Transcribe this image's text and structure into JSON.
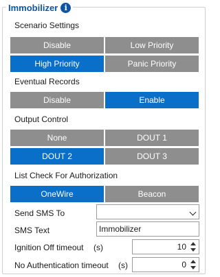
{
  "group": {
    "title": "Immobilizer"
  },
  "scenario": {
    "label": "Scenario Settings",
    "options": [
      "Disable",
      "Low Priority",
      "High Priority",
      "Panic Priority"
    ],
    "selected": "High Priority"
  },
  "eventual": {
    "label": "Eventual Records",
    "options": [
      "Disable",
      "Enable"
    ],
    "selected": "Enable"
  },
  "output": {
    "label": "Output Control",
    "options": [
      "None",
      "DOUT 1",
      "DOUT 2",
      "DOUT 3"
    ],
    "selected": "DOUT 2"
  },
  "list_check": {
    "label": "List Check For Authorization",
    "options": [
      "OneWire",
      "Beacon"
    ],
    "selected": "OneWire"
  },
  "sms_to": {
    "label": "Send SMS To",
    "value": ""
  },
  "sms_text": {
    "label": "SMS Text",
    "value": "Immobilizer"
  },
  "ignition_timeout": {
    "label": "Ignition Off timeout",
    "unit": "(s)",
    "value": "10"
  },
  "no_auth_timeout": {
    "label": "No Authentication timeout",
    "unit": "(s)",
    "value": "0"
  }
}
